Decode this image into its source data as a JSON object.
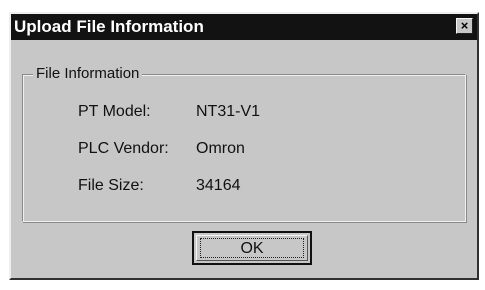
{
  "dialog": {
    "title": "Upload File Information",
    "close_glyph": "×",
    "close_icon": "close-icon"
  },
  "group": {
    "legend": "File Information",
    "rows": [
      {
        "label": "PT Model:",
        "value": "NT31-V1"
      },
      {
        "label": "PLC Vendor:",
        "value": "Omron"
      },
      {
        "label": "File Size:",
        "value": "34164"
      }
    ]
  },
  "buttons": {
    "ok_label": "OK"
  },
  "colors": {
    "titlebar": "#121212",
    "face": "#c7c7c7",
    "title_text": "#ffffff"
  }
}
